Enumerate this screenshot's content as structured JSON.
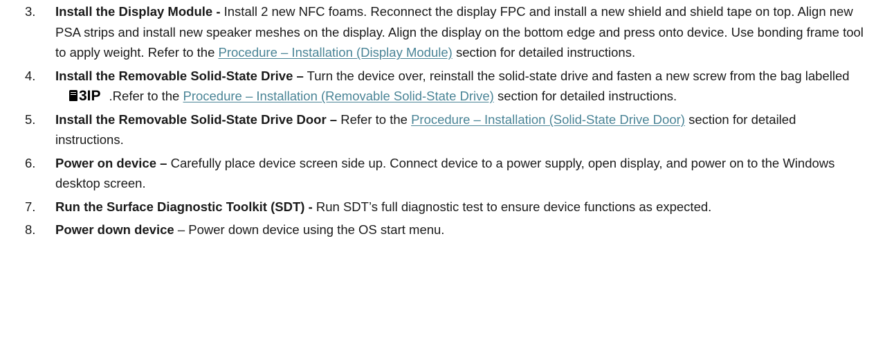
{
  "steps": [
    {
      "number": "3.",
      "title": "Install the Display Module -",
      "text": "Install 2 new NFC foams. Reconnect the display FPC and install a new shield and shield tape on top. Align new PSA strips and install new speaker meshes on the display. Align the display on the bottom edge and press onto device. Use bonding frame tool to apply weight. Refer to the",
      "link": "Procedure – Installation (Display Module)",
      "after": "section for detailed instructions."
    },
    {
      "number": "4.",
      "title": "Install the Removable Solid-State Drive –",
      "text": "Turn the device over, reinstall the solid-state drive and fasten a new screw from the bag labelled",
      "bag_label": "3IP",
      "text2": ".Refer to the",
      "link": "Procedure – Installation (Removable Solid-State Drive)",
      "after": "section for detailed instructions."
    },
    {
      "number": "5.",
      "title": "Install the Removable Solid-State Drive Door –",
      "text": "Refer to the",
      "link": "Procedure – Installation (Solid-State Drive Door)",
      "after": "section for detailed instructions."
    },
    {
      "number": "6.",
      "title": "Power on device –",
      "text": "Carefully place device screen side up. Connect device to a power supply, open display, and power on to the Windows desktop screen."
    },
    {
      "number": "7.",
      "title": "Run the Surface Diagnostic Toolkit (SDT) -",
      "text": "Run SDT’s full diagnostic test to ensure device functions as expected."
    },
    {
      "number": "8.",
      "title": "Power down device",
      "text": "– Power down device using the OS start menu."
    }
  ],
  "colors": {
    "text": "#1a1a1a",
    "link": "#4a8496"
  },
  "icons": {
    "bag": "bag-icon"
  }
}
